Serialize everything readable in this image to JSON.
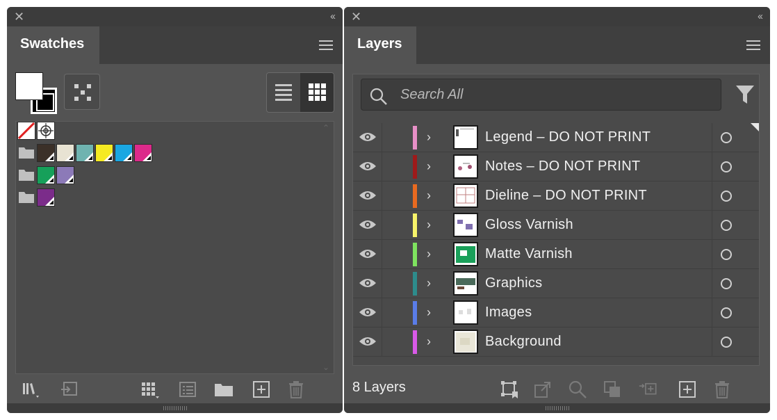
{
  "swatches_panel": {
    "title": "Swatches",
    "swatch_rows": [
      {
        "group": false,
        "swatches": [
          {
            "type": "none"
          },
          {
            "type": "registration"
          }
        ]
      },
      {
        "group": true,
        "swatches": [
          {
            "type": "spot",
            "color": "#3b3028"
          },
          {
            "type": "spot",
            "color": "#e8e3d3"
          },
          {
            "type": "spot",
            "color": "#6fb3b0"
          },
          {
            "type": "spot",
            "color": "#f5ea22"
          },
          {
            "type": "spot",
            "color": "#1aa7e2"
          },
          {
            "type": "spot",
            "color": "#dc2a8a"
          }
        ]
      },
      {
        "group": true,
        "swatches": [
          {
            "type": "spot",
            "color": "#16a05a"
          },
          {
            "type": "spot",
            "color": "#8c7ab8"
          }
        ]
      },
      {
        "group": true,
        "swatches": [
          {
            "type": "spot",
            "color": "#7b2c8a"
          }
        ]
      }
    ],
    "bottom_icons": [
      "swatch-libraries-icon",
      "place-swatches-icon",
      "show-swatch-kinds-icon",
      "swatch-options-icon",
      "new-color-group-icon",
      "new-swatch-icon",
      "delete-swatch-icon"
    ]
  },
  "layers_panel": {
    "title": "Layers",
    "search": {
      "placeholder": "Search All"
    },
    "layers": [
      {
        "name": "Legend – DO NOT PRINT",
        "color": "#e78fc7",
        "selected": true
      },
      {
        "name": "Notes – DO NOT PRINT",
        "color": "#9e1a1a",
        "selected": false
      },
      {
        "name": "Dieline – DO NOT PRINT",
        "color": "#e86a20",
        "selected": false
      },
      {
        "name": "Gloss Varnish",
        "color": "#f7f36a",
        "selected": false
      },
      {
        "name": "Matte Varnish",
        "color": "#7fe35f",
        "selected": false
      },
      {
        "name": "Graphics",
        "color": "#2d8c8c",
        "selected": false
      },
      {
        "name": "Images",
        "color": "#5a7de8",
        "selected": false
      },
      {
        "name": "Background",
        "color": "#d95ae8",
        "selected": false
      }
    ],
    "layer_count": "8 Layers",
    "bottom_icons": [
      "collect-for-export-icon",
      "export-icon",
      "locate-object-icon",
      "make-clipping-mask-icon",
      "create-sublayer-icon",
      "create-new-layer-icon",
      "delete-layer-icon"
    ]
  }
}
